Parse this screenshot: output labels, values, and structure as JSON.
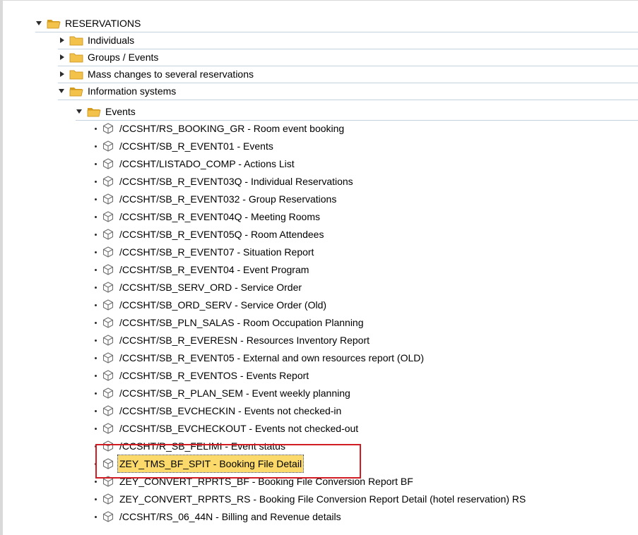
{
  "tree": {
    "root": {
      "label": "RESERVATIONS",
      "state": "expanded"
    },
    "folders": [
      {
        "label": "Individuals",
        "state": "collapsed"
      },
      {
        "label": "Groups / Events",
        "state": "collapsed"
      },
      {
        "label": "Mass changes to several reservations",
        "state": "collapsed"
      },
      {
        "label": "Information systems",
        "state": "expanded"
      }
    ],
    "subfolder": {
      "label": "Events",
      "state": "expanded"
    },
    "transactions": [
      "/CCSHT/RS_BOOKING_GR - Room event booking",
      "/CCSHT/SB_R_EVENT01 - Events",
      "/CCSHT/LISTADO_COMP - Actions List",
      "/CCSHT/SB_R_EVENT03Q - Individual Reservations",
      "/CCSHT/SB_R_EVENT032 - Group Reservations",
      "/CCSHT/SB_R_EVENT04Q - Meeting Rooms",
      "/CCSHT/SB_R_EVENT05Q - Room Attendees",
      "/CCSHT/SB_R_EVENT07 - Situation Report",
      "/CCSHT/SB_R_EVENT04 - Event Program",
      "/CCSHT/SB_SERV_ORD - Service Order",
      "/CCSHT/SB_ORD_SERV - Service Order (Old)",
      "/CCSHT/SB_PLN_SALAS - Room Occupation Planning",
      "/CCSHT/SB_R_EVERESN - Resources Inventory Report",
      "/CCSHT/SB_R_EVENT05 - External and own resources report (OLD)",
      "/CCSHT/SB_R_EVENTOS - Events Report",
      "/CCSHT/SB_R_PLAN_SEM - Event weekly planning",
      "/CCSHT/SB_EVCHECKIN - Events not checked-in",
      "/CCSHT/SB_EVCHECKOUT - Events not checked-out",
      "/CCSHT/R_SB_FELIMI - Event status",
      "ZEY_TMS_BF_SPIT - Booking File Detail",
      "ZEY_CONVERT_RPRTS_BF - Booking File Conversion Report  BF",
      "ZEY_CONVERT_RPRTS_RS - Booking File Conversion Report Detail (hotel reservation) RS",
      "/CCSHT/RS_06_44N - Billing and Revenue details"
    ],
    "selected_index": 19
  },
  "colors": {
    "folder": "#f2c24b",
    "folder_dark": "#d79d1f",
    "selection": "#fbd96b",
    "highlight_box": "#d01c22",
    "separator": "#c6d3de"
  },
  "icons": {
    "expanded": "triangle-down",
    "collapsed": "triangle-right",
    "folder_closed": "folder-icon",
    "folder_open": "folder-open-icon",
    "transaction": "cube-icon"
  }
}
